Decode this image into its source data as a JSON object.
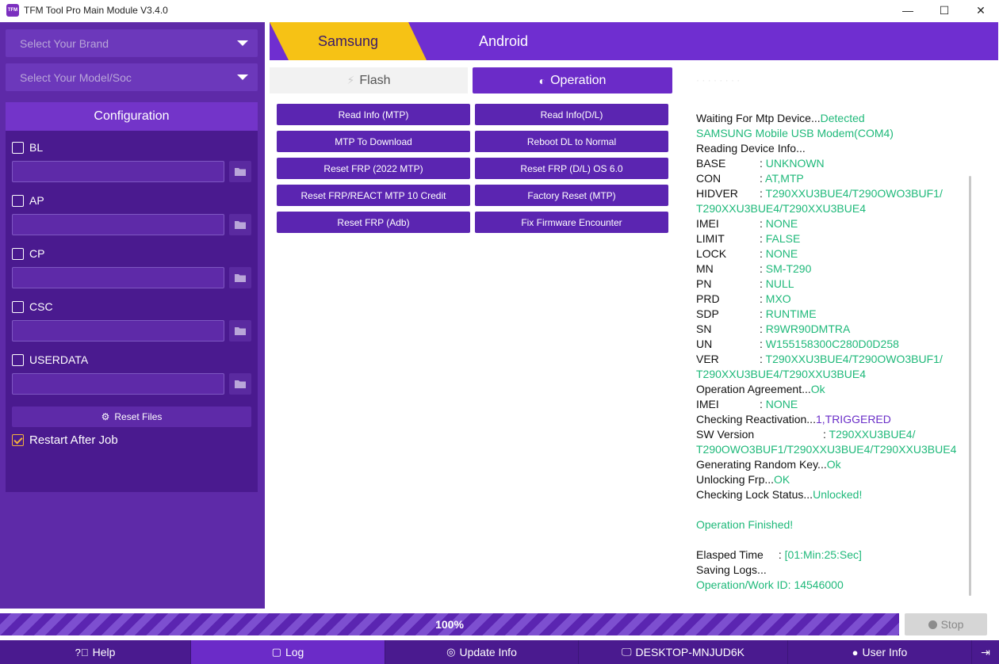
{
  "window": {
    "title": "TFM Tool Pro Main Module V3.4.0",
    "logo_text": "TFM",
    "controls": {
      "minimize": "—",
      "maximize": "☐",
      "close": "✕"
    }
  },
  "left": {
    "brand_select": "Select Your Brand",
    "model_select": "Select Your Model/Soc",
    "config_title": "Configuration",
    "items": [
      {
        "label": "BL",
        "checked": false
      },
      {
        "label": "AP",
        "checked": false
      },
      {
        "label": "CP",
        "checked": false
      },
      {
        "label": "CSC",
        "checked": false
      },
      {
        "label": "USERDATA",
        "checked": false
      }
    ],
    "reset_files": "Reset Files",
    "restart_after_job": {
      "label": "Restart After Job",
      "checked": true
    }
  },
  "top_tabs": {
    "samsung": "Samsung",
    "android": "Android"
  },
  "sub_tabs": {
    "flash": "Flash",
    "operation": "Operation"
  },
  "operations": [
    "Read Info (MTP)",
    "Read Info(D/L)",
    "MTP To Download",
    "Reboot DL to Normal",
    "Reset FRP (2022 MTP)",
    "Reset FRP (D/L) OS 6.0",
    "Reset FRP/REACT MTP 10 Credit",
    "Factory Reset (MTP)",
    "Reset FRP (Adb)",
    "Fix Firmware Encounter"
  ],
  "log": {
    "ghost": "· · · · · · · ·",
    "lines": [
      {
        "k": "Waiting For Mtp Device...",
        "v": "Detected"
      },
      {
        "v": "SAMSUNG Mobile USB Modem(COM4)"
      },
      {
        "k": "Reading Device Info..."
      },
      {
        "label": "BASE",
        "v": "UNKNOWN"
      },
      {
        "label": "CON",
        "v": "AT,MTP"
      },
      {
        "label": "HIDVER",
        "v": "T290XXU3BUE4/T290OWO3BUF1/"
      },
      {
        "v": "T290XXU3BUE4/T290XXU3BUE4"
      },
      {
        "label": "IMEI",
        "v": "NONE"
      },
      {
        "label": "LIMIT",
        "v": "FALSE"
      },
      {
        "label": "LOCK",
        "v": "NONE"
      },
      {
        "label": "MN",
        "v": "SM-T290"
      },
      {
        "label": "PN",
        "v": "NULL"
      },
      {
        "label": "PRD",
        "v": "MXO"
      },
      {
        "label": "SDP",
        "v": "RUNTIME"
      },
      {
        "label": "SN",
        "v": "R9WR90DMTRA"
      },
      {
        "label": "UN",
        "v": "W155158300C280D0D258"
      },
      {
        "label": "VER",
        "v": "T290XXU3BUE4/T290OWO3BUF1/"
      },
      {
        "v": "T290XXU3BUE4/T290XXU3BUE4"
      },
      {
        "k": "Operation Agreement...",
        "v": "Ok"
      },
      {
        "label": "IMEI",
        "v": "NONE"
      },
      {
        "k": "Checking Reactivation...",
        "p": "1,TRIGGERED"
      },
      {
        "label2": "SW Version",
        "v": "T290XXU3BUE4/"
      },
      {
        "v": "T290OWO3BUF1/T290XXU3BUE4/T290XXU3BUE4"
      },
      {
        "k": "Generating Random Key...",
        "v": "Ok"
      },
      {
        "k": "Unlocking Frp...",
        "v": "OK"
      },
      {
        "k": "Checking Lock Status...",
        "v": "Unlocked!"
      },
      {
        "blank": true
      },
      {
        "v": "Operation Finished!"
      },
      {
        "blank": true
      },
      {
        "label": "Elasped Time",
        "sep": " :  ",
        "v": "[01:Min:25:Sec]",
        "wide": true
      },
      {
        "k": "Saving Logs..."
      },
      {
        "v": "Operation/Work ID: 14546000"
      }
    ]
  },
  "progress": {
    "value": 1.0,
    "label": "100%"
  },
  "stop": "Stop",
  "bottom": {
    "help": "Help",
    "log": "Log",
    "update_info": "Update Info",
    "desktop": "DESKTOP-MNJUD6K",
    "user_info": "User Info",
    "logout_icon": "logout-icon"
  },
  "colors": {
    "primary": "#5b25b1",
    "accent": "#f6c215",
    "success": "#1fb97a",
    "highlight": "#6a2ec8"
  }
}
